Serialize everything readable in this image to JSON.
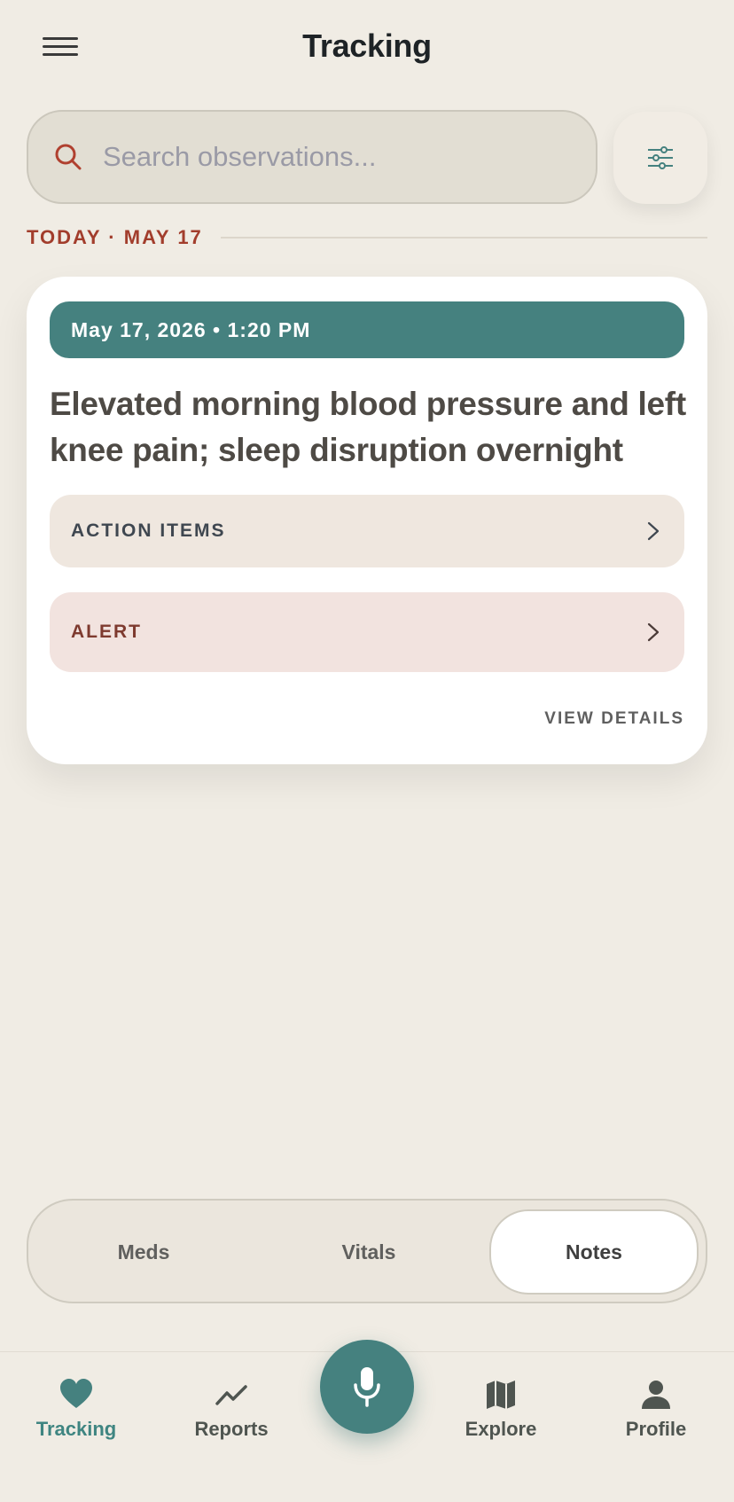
{
  "header": {
    "title": "Tracking"
  },
  "search": {
    "placeholder": "Search observations..."
  },
  "section": {
    "date_label": "TODAY · MAY 17"
  },
  "card": {
    "timestamp": "May 17, 2026 • 1:20 PM",
    "headline": "Elevated morning blood pressure and left knee pain; sleep disruption overnight",
    "action_items_label": "ACTION ITEMS",
    "alert_label": "ALERT",
    "view_details_label": "VIEW DETAILS"
  },
  "segments": [
    {
      "label": "Meds"
    },
    {
      "label": "Vitals"
    },
    {
      "label": "Notes",
      "selected": true
    }
  ],
  "nav": {
    "items": [
      {
        "label": "Tracking",
        "icon": "heart-icon",
        "active": true
      },
      {
        "label": "Reports",
        "icon": "trend-icon"
      },
      {
        "label": "Explore",
        "icon": "map-icon"
      },
      {
        "label": "Profile",
        "icon": "person-icon"
      }
    ],
    "center": {
      "icon": "microphone-icon"
    }
  },
  "colors": {
    "background": "#f0ece4",
    "accent_teal": "#45817f",
    "date_red": "#a23d2c",
    "alert_bg": "#f2e3df",
    "action_bg": "#efe7df"
  }
}
